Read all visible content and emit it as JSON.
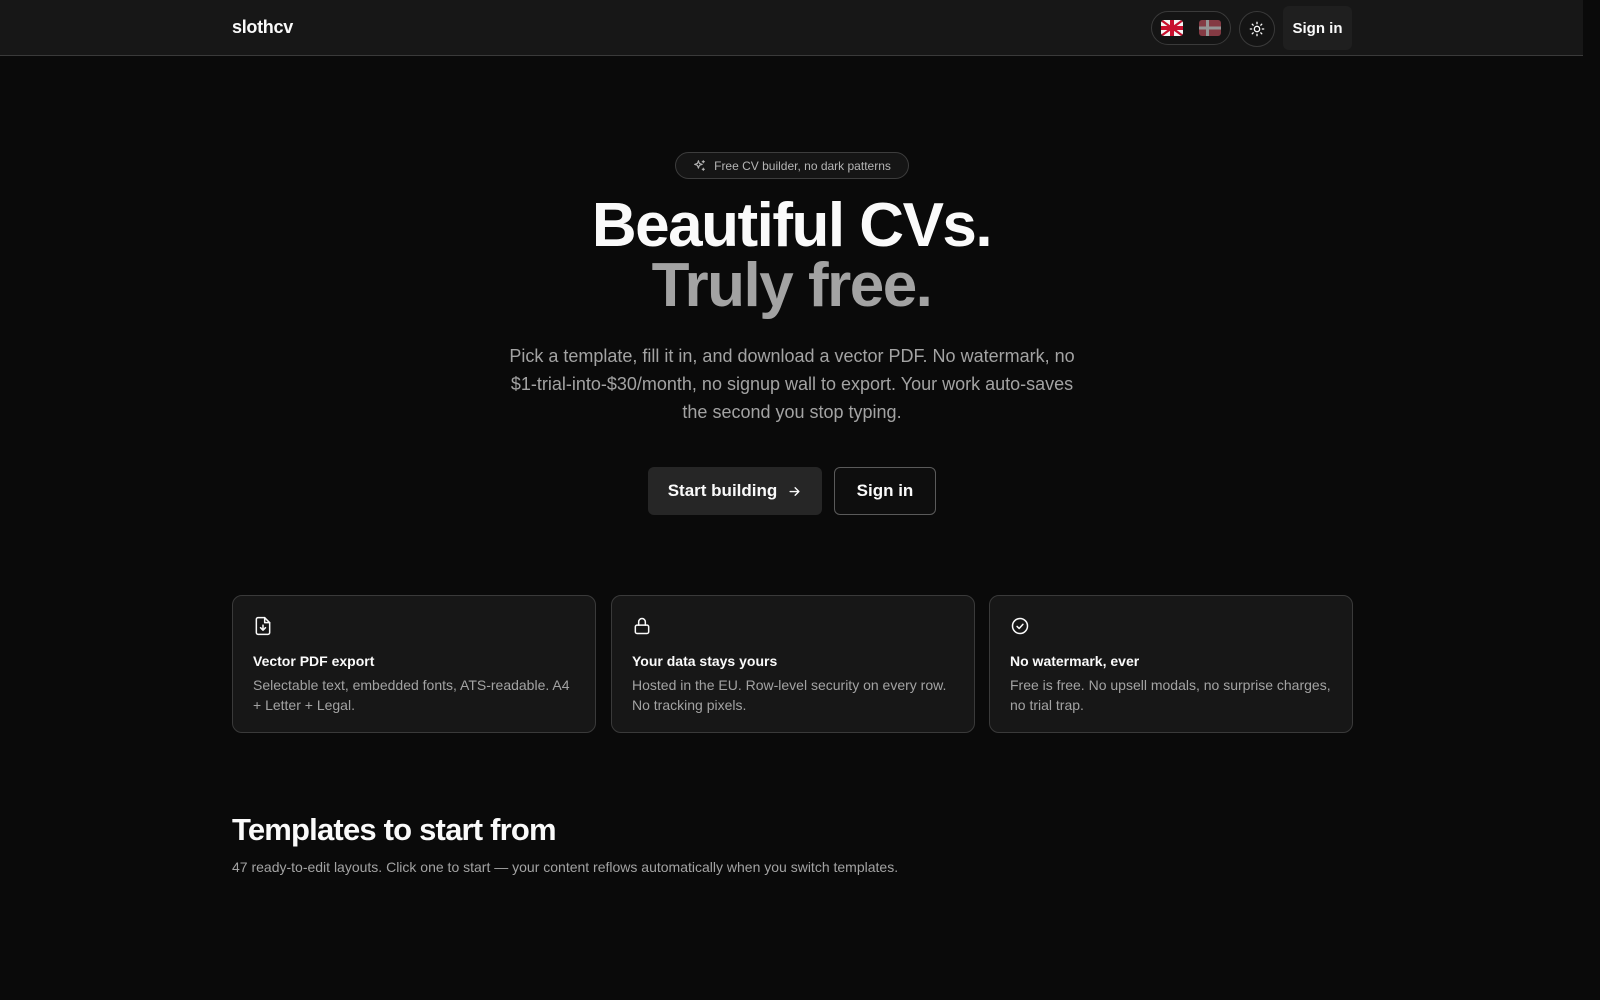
{
  "header": {
    "brand": "slothcv",
    "languages": [
      {
        "name": "english-flag-icon"
      },
      {
        "name": "danish-flag-icon"
      }
    ],
    "theme_icon": "sun-icon",
    "signin_label": "Sign in"
  },
  "hero": {
    "badge_icon": "sparkles-icon",
    "badge_text": "Free CV builder, no dark patterns",
    "title_line1": "Beautiful CVs.",
    "title_line2": "Truly free.",
    "subtitle": "Pick a template, fill it in, and download a vector PDF. No watermark, no $1-trial-into-$30/month, no signup wall to export. Your work auto-saves the second you stop typing.",
    "primary_cta": "Start building",
    "primary_cta_icon": "arrow-right-icon",
    "secondary_cta": "Sign in"
  },
  "features": [
    {
      "icon": "file-download-icon",
      "title": "Vector PDF export",
      "description": "Selectable text, embedded fonts, ATS-readable. A4 + Letter + Legal."
    },
    {
      "icon": "lock-icon",
      "title": "Your data stays yours",
      "description": "Hosted in the EU. Row-level security on every row. No tracking pixels."
    },
    {
      "icon": "check-circle-icon",
      "title": "No watermark, ever",
      "description": "Free is free. No upsell modals, no surprise charges, no trial trap."
    }
  ],
  "templates_section": {
    "title": "Templates to start from",
    "subtitle": "47 ready-to-edit layouts. Click one to start — your content reflows automatically when you switch templates."
  },
  "colors": {
    "background": "#0a0a0a",
    "header": "#171717",
    "muted_text": "#a3a3a3",
    "text": "#fafafa"
  }
}
